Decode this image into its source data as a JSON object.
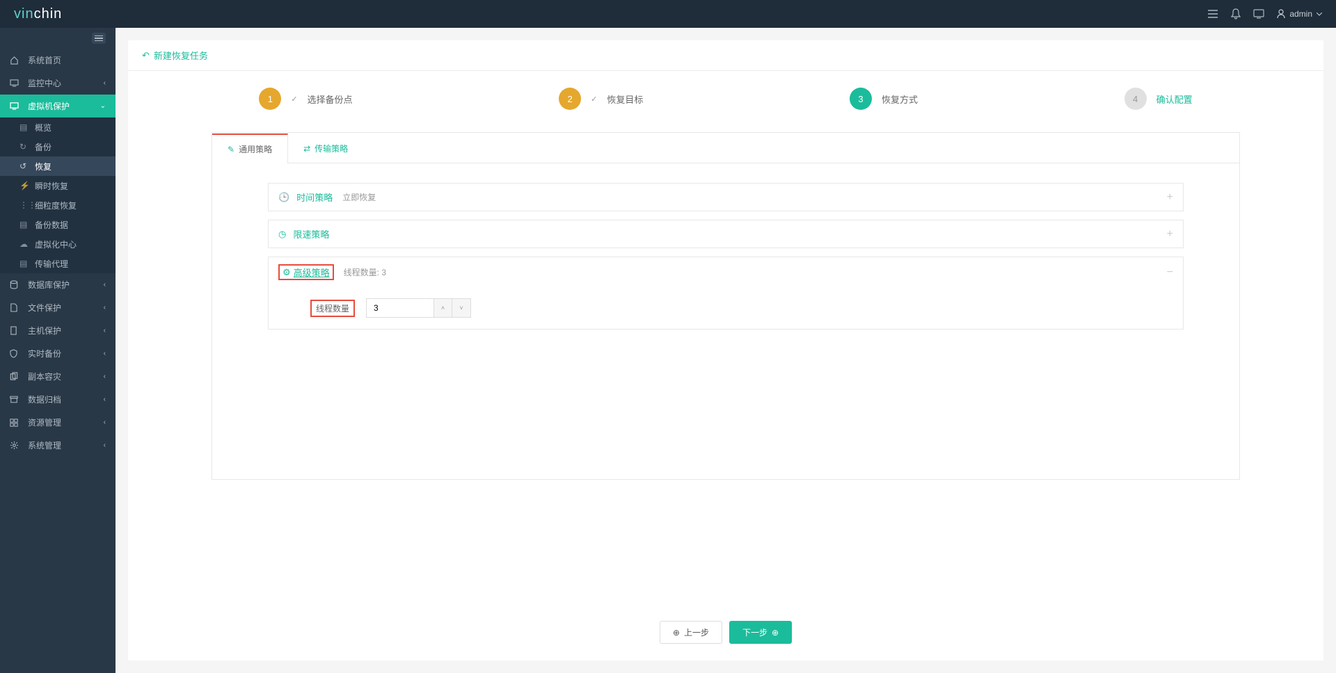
{
  "logo": {
    "part1": "vin",
    "part2": "chin"
  },
  "user": {
    "name": "admin"
  },
  "sidebar": {
    "items": [
      {
        "label": "系统首页"
      },
      {
        "label": "监控中心"
      },
      {
        "label": "虚拟机保护"
      },
      {
        "label": "数据库保护"
      },
      {
        "label": "文件保护"
      },
      {
        "label": "主机保护"
      },
      {
        "label": "实时备份"
      },
      {
        "label": "副本容灾"
      },
      {
        "label": "数据归档"
      },
      {
        "label": "资源管理"
      },
      {
        "label": "系统管理"
      }
    ],
    "vmSub": [
      {
        "label": "概览"
      },
      {
        "label": "备份"
      },
      {
        "label": "恢复"
      },
      {
        "label": "瞬时恢复"
      },
      {
        "label": "细粒度恢复"
      },
      {
        "label": "备份数据"
      },
      {
        "label": "虚拟化中心"
      },
      {
        "label": "传输代理"
      }
    ]
  },
  "page": {
    "title": "新建恢复任务"
  },
  "wizard": {
    "steps": [
      {
        "num": "1",
        "label": "选择备份点"
      },
      {
        "num": "2",
        "label": "恢复目标"
      },
      {
        "num": "3",
        "label": "恢复方式"
      },
      {
        "num": "4",
        "label": "确认配置"
      }
    ]
  },
  "tabs": {
    "general": "通用策略",
    "transfer": "传输策略"
  },
  "strategy": {
    "time": {
      "title": "时间策略",
      "sub": "立即恢复"
    },
    "speed": {
      "title": "限速策略"
    },
    "advanced": {
      "title": "高级策略",
      "sub": "线程数量: 3",
      "threadLabel": "线程数量",
      "threadValue": "3"
    }
  },
  "buttons": {
    "prev": "上一步",
    "next": "下一步"
  }
}
